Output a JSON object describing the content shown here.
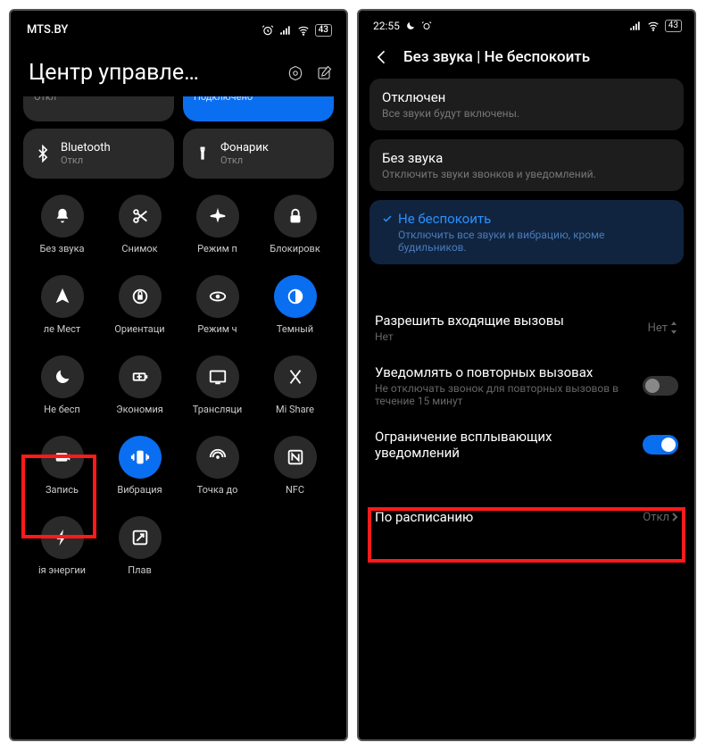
{
  "left": {
    "carrier": "MTS.BY",
    "battery": "43",
    "title": "Центр управле…",
    "partial_tiles": [
      {
        "sub": "Откл"
      },
      {
        "sub": "Подключено"
      }
    ],
    "tiles": [
      {
        "label": "Bluetooth",
        "sub": "Откл",
        "icon": "bluetooth"
      },
      {
        "label": "Фонарик",
        "sub": "Откл",
        "icon": "flashlight"
      }
    ],
    "grid": [
      {
        "label": "Без звука",
        "icon": "bell"
      },
      {
        "label": "Снимок",
        "icon": "scissors"
      },
      {
        "label": "Режим п",
        "icon": "airplane"
      },
      {
        "label": "Блокировк",
        "icon": "lock"
      },
      {
        "label": "ле   Мест",
        "icon": "compass"
      },
      {
        "label": "Ориентаци",
        "icon": "rotate-lock"
      },
      {
        "label": "Режим ч",
        "icon": "eye"
      },
      {
        "label": "Темный",
        "icon": "dark-mode",
        "active": true
      },
      {
        "label": "Не бесп",
        "icon": "moon",
        "highlighted": true
      },
      {
        "label": "Экономия",
        "icon": "battery-plus"
      },
      {
        "label": "Трансляци",
        "icon": "cast"
      },
      {
        "label": "Mi Share",
        "icon": "mishare"
      },
      {
        "label": "Запись",
        "icon": "camera"
      },
      {
        "label": "Вибрация",
        "icon": "vibrate",
        "active": true
      },
      {
        "label": "Точка до",
        "icon": "hotspot"
      },
      {
        "label": "NFC",
        "icon": "nfc"
      },
      {
        "label": "ія энергии",
        "icon": "bolt"
      },
      {
        "label": "Плав",
        "icon": "float-window"
      }
    ]
  },
  "right": {
    "time": "22:55",
    "battery": "43",
    "title": "Без звука | Не беспокоить",
    "options": [
      {
        "title": "Отключен",
        "sub": "Все звуки будут включены."
      },
      {
        "title": "Без звука",
        "sub": "Отключить звуки звонков и уведомлений."
      },
      {
        "title": "Не беспокоить",
        "sub": "Отключить все звуки и вибрацию, кроме будильников.",
        "selected": true
      }
    ],
    "settings": {
      "allow_calls": {
        "title": "Разрешить входящие вызовы",
        "sub": "Нет",
        "value": "Нет"
      },
      "repeat_calls": {
        "title": "Уведомлять о повторных вызовах",
        "sub": "Не отключать звонок для повторных вызовов в течение 15 минут",
        "on": false
      },
      "popup_limit": {
        "title": "Ограничение всплывающих уведомлений",
        "on": true,
        "highlighted": true
      },
      "schedule": {
        "title": "По расписанию",
        "value": "Откл"
      }
    }
  }
}
